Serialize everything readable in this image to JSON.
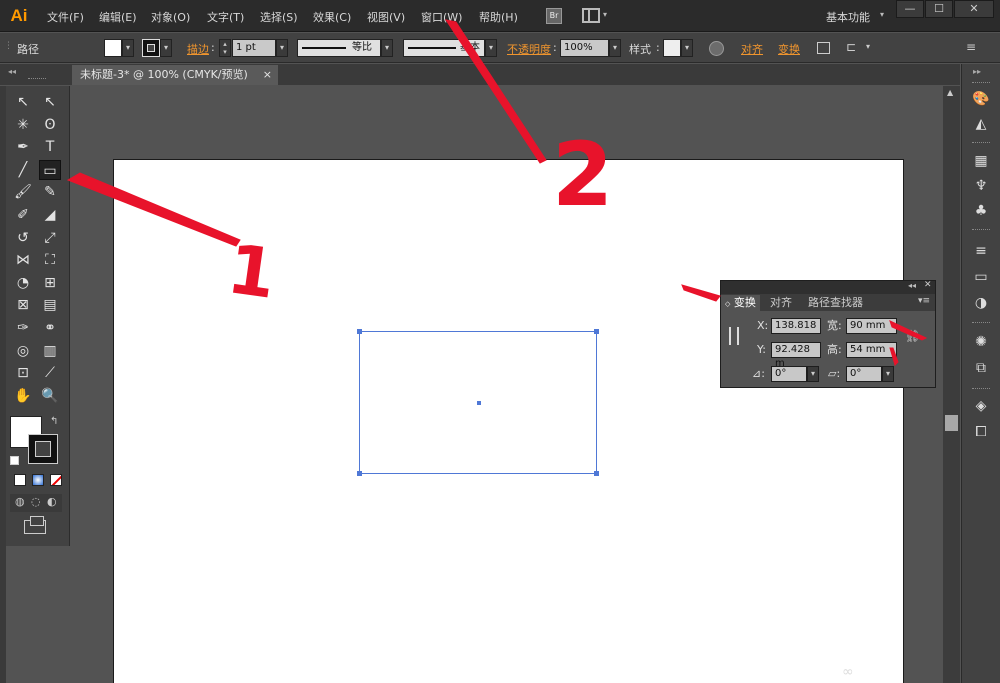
{
  "app": {
    "logo": "Ai"
  },
  "menus": [
    "文件(F)",
    "编辑(E)",
    "对象(O)",
    "文字(T)",
    "选择(S)",
    "效果(C)",
    "视图(V)",
    "窗口(W)",
    "帮助(H)"
  ],
  "menubar": {
    "bridge_label": "Br",
    "workspace": "基本功能",
    "workspace_arrow": "▾"
  },
  "window_controls": {
    "minimize": "—",
    "maximize": "☐",
    "close": "✕"
  },
  "control_bar": {
    "object_type": "路径",
    "stroke_link": "描边",
    "stroke_weight": "1 pt",
    "stroke_profile_label": "等比",
    "brush_label": "基本",
    "opacity_link": "不透明度",
    "opacity_value": "100%",
    "style_label": "样式",
    "align_link": "对齐",
    "transform_link": "变换"
  },
  "document": {
    "tab_title": "未标题-3* @ 100% (CMYK/预览)",
    "tab_close": "×"
  },
  "tools": {
    "rows": [
      [
        "selection-icon",
        "direct-selection-icon"
      ],
      [
        "magic-wand-icon",
        "lasso-icon"
      ],
      [
        "pen-icon",
        "type-icon"
      ],
      [
        "line-segment-icon",
        "rectangle-icon"
      ],
      [
        "paintbrush-icon",
        "pencil-icon"
      ],
      [
        "blob-brush-icon",
        "eraser-icon"
      ],
      [
        "rotate-icon",
        "scale-icon"
      ],
      [
        "width-icon",
        "free-transform-icon"
      ],
      [
        "shape-builder-icon",
        "perspective-grid-icon"
      ],
      [
        "mesh-icon",
        "gradient-icon"
      ],
      [
        "eyedropper-icon",
        "blend-icon"
      ],
      [
        "symbol-sprayer-icon",
        "column-graph-icon"
      ],
      [
        "artboard-icon",
        "slice-icon"
      ],
      [
        "hand-icon",
        "zoom-icon"
      ]
    ],
    "glyphs": [
      [
        "↖",
        "↖"
      ],
      [
        "✳",
        "ʘ"
      ],
      [
        "✒",
        "T"
      ],
      [
        "╱",
        "▭"
      ],
      [
        "🖌",
        "✎"
      ],
      [
        "✐",
        "◢"
      ],
      [
        "↺",
        "⤢"
      ],
      [
        "⋈",
        "⛶"
      ],
      [
        "◔",
        "⊞"
      ],
      [
        "⊠",
        "▤"
      ],
      [
        "✑",
        "⚭"
      ],
      [
        "◎",
        "▥"
      ],
      [
        "⊡",
        "⟋"
      ],
      [
        "✋",
        "🔍"
      ]
    ],
    "selected": "rectangle-icon"
  },
  "transform_panel": {
    "tabs": [
      "变换",
      "对齐",
      "路径查找器"
    ],
    "x_label": "X:",
    "x_value": "138.818",
    "y_label": "Y:",
    "y_value": "92.428 m",
    "w_label": "宽:",
    "w_value": "90 mm",
    "h_label": "高:",
    "h_value": "54 mm",
    "rotate_value": "0°",
    "shear_value": "0°"
  },
  "annotations": {
    "label_1": "1",
    "label_2": "2"
  },
  "colors": {
    "annotation_red": "#e8132b",
    "selection_blue": "#4f78d6",
    "accent_orange": "#f0952e"
  }
}
